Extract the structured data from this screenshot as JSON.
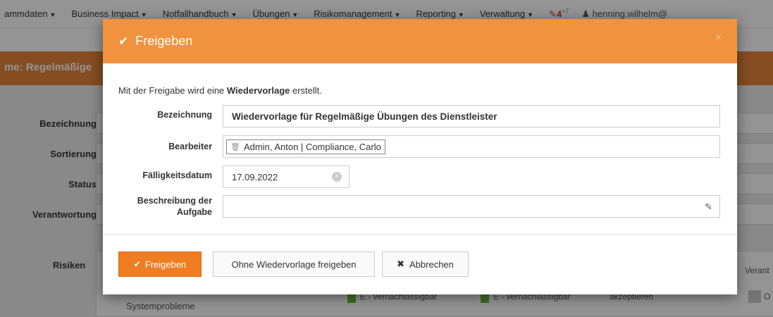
{
  "nav": {
    "items": [
      "ammdaten",
      "Business Impact",
      "Notfallhandbuch",
      "Übungen",
      "Risikomanagement",
      "Reporting",
      "Verwaltung"
    ],
    "notification_count": "4",
    "notification_sup": "+7",
    "user": "henning.wilhelm@"
  },
  "page": {
    "title": "me: Regelmäßige",
    "fields": [
      "Bezeichnung",
      "Sortierung",
      "Status",
      "Verantwortung"
    ],
    "risiken_label": "Risiken",
    "risk_row": {
      "name": "Systemprobleme",
      "col1": "E - vernachlässigbar",
      "col2": "E - vernachlässigbar",
      "col3": "akzeptieren",
      "header_right": "Verant",
      "owner_initial": "O"
    }
  },
  "modal": {
    "title": "Freigeben",
    "intro_prefix": "Mit der Freigabe wird eine ",
    "intro_bold": "Wiedervorlage",
    "intro_suffix": " erstellt.",
    "bezeichnung_label": "Bezeichnung",
    "bezeichnung_value": "Wiedervorlage für Regelmäßige Übungen des Dienstleister",
    "bearbeiter_label": "Bearbeiter",
    "bearbeiter_tag": "Admin, Anton | Compliance, Carlo",
    "faellig_label": "Fälligkeitsdatum",
    "faellig_value": "17.09.2022",
    "beschreibung_label_line1": "Beschreibung der",
    "beschreibung_label_line2": "Aufgabe",
    "beschreibung_value": "",
    "buttons": {
      "freigeben": "Freigeben",
      "ohne": "Ohne Wiedervorlage freigeben",
      "abbrechen": "Abbrechen"
    }
  },
  "colors": {
    "modal_header": "#f0923e",
    "primary_button": "#ef7d22",
    "page_titlebar": "#e6863a",
    "risk_green": "#6abf3a"
  }
}
